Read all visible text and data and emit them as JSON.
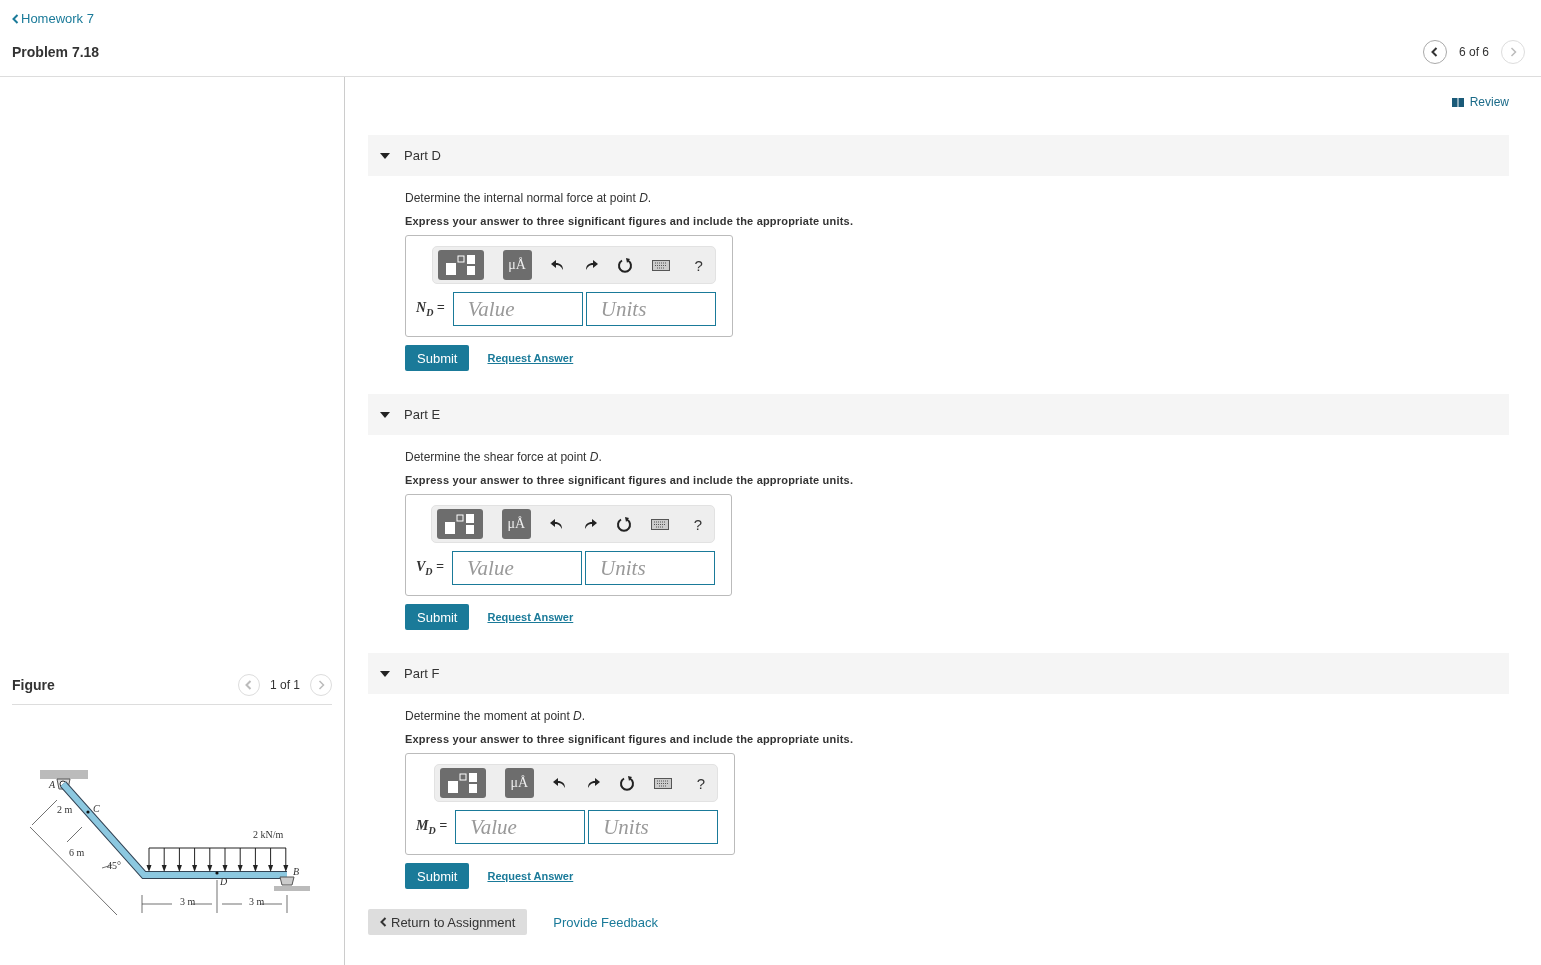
{
  "header": {
    "back_link": "Homework 7",
    "title": "Problem 7.18",
    "pager": "6 of 6"
  },
  "figure_panel": {
    "title": "Figure",
    "pager": "1 of 1",
    "labels": [
      "A",
      "C",
      "2 m",
      "6 m",
      "45°",
      "2 kN/m",
      "B",
      "D",
      "3 m",
      "3 m"
    ]
  },
  "review_link": "Review",
  "parts": [
    {
      "title": "Part D",
      "expanded": true,
      "question": "Determine the internal normal force at point *D*.",
      "instruction": "Express your answer to three significant figures and include the appropriate units.",
      "units_tool": "μÅ",
      "help": "?",
      "label": "N$_{D}$ =",
      "value_placeholder": "Value",
      "units_placeholder": "Units",
      "submit": "Submit",
      "request": "Request Answer"
    },
    {
      "title": "Part E",
      "expanded": true,
      "question": "Determine the shear force at point *D*.",
      "instruction": "Express your answer to three significant figures and include the appropriate units.",
      "units_tool": "μÅ",
      "help": "?",
      "label": "V$_{D}$ =",
      "value_placeholder": "Value",
      "units_placeholder": "Units",
      "submit": "Submit",
      "request": "Request Answer"
    },
    {
      "title": "Part F",
      "expanded": true,
      "question": "Determine the moment at point *D*.",
      "instruction": "Express your answer to three significant figures and include the appropriate units.",
      "units_tool": "μÅ",
      "help": "?",
      "label": "M$_{D}$ =",
      "value_placeholder": "Value",
      "units_placeholder": "Units",
      "submit": "Submit",
      "request": "Request Answer"
    }
  ],
  "footer": {
    "return_button": "Return to Assignment",
    "feedback_link": "Provide Feedback"
  }
}
